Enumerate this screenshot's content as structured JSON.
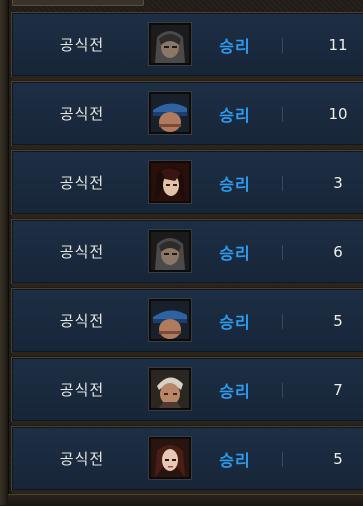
{
  "matches": [
    {
      "mode": "공식전",
      "result": "승리",
      "score": "11",
      "avatar": "hooded-fighter-icon",
      "accent": "#6b6b6b"
    },
    {
      "mode": "공식전",
      "result": "승리",
      "score": "10",
      "avatar": "blue-cap-soldier-icon",
      "accent": "#3a74b8"
    },
    {
      "mode": "공식전",
      "result": "승리",
      "score": "3",
      "avatar": "dark-hair-swordsman-icon",
      "accent": "#7a2018"
    },
    {
      "mode": "공식전",
      "result": "승리",
      "score": "6",
      "avatar": "hooded-fighter-icon",
      "accent": "#6b6b6b"
    },
    {
      "mode": "공식전",
      "result": "승리",
      "score": "5",
      "avatar": "blue-cap-soldier-icon",
      "accent": "#3a74b8"
    },
    {
      "mode": "공식전",
      "result": "승리",
      "score": "7",
      "avatar": "white-hair-brawler-icon",
      "accent": "#c9c2b6"
    },
    {
      "mode": "공식전",
      "result": "승리",
      "score": "5",
      "avatar": "female-mage-icon",
      "accent": "#8a3a2a"
    }
  ],
  "colors": {
    "win_text": "#2e9bf0",
    "row_bg": "#1a2a3e",
    "frame_bg": "#1e1a15"
  }
}
